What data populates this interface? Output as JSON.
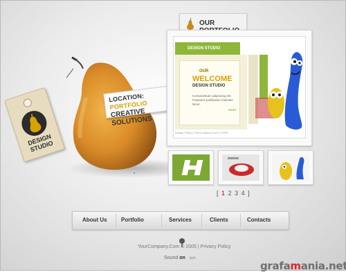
{
  "tag": {
    "text": "DESIGN STUDIO"
  },
  "location_card": {
    "line1_prefix": "LOCATION:",
    "line1_highlight": "PORTFOLIO",
    "line2": "CREATIVE SOLUTIONS"
  },
  "portfolio": {
    "title": "OUR PORTFOLIO",
    "preview": {
      "header": "DESIGN STUDIO",
      "our": "OUR",
      "welcome": "WELCOME",
      "subtitle": "DESIGN STUDIO",
      "body": "Consectetuer adipiscing elit. Praesent vestibulum molestie lacus.",
      "more": "more",
      "footer": "Design Policy | YourCompany.Com © 2005"
    }
  },
  "pagination": {
    "open": "[",
    "pages": [
      "1",
      "2",
      "3",
      "4"
    ],
    "close": "]",
    "current": "1"
  },
  "nav": {
    "items": [
      "About Us",
      "Portfolio",
      "Services",
      "Clients",
      "Contacts"
    ]
  },
  "footer": {
    "copyright": "YourCompany.Com © 2005 | Privacy Policy"
  },
  "sound": {
    "label": "Sound",
    "on": "on",
    "off": "lash"
  },
  "watermark": {
    "pre": "gra",
    "mid": "fa",
    "m": "m",
    "post": "ania.net"
  },
  "colors": {
    "accent_green": "#8fb63a",
    "accent_gold": "#d9a200",
    "pear": "#d98c2a"
  }
}
